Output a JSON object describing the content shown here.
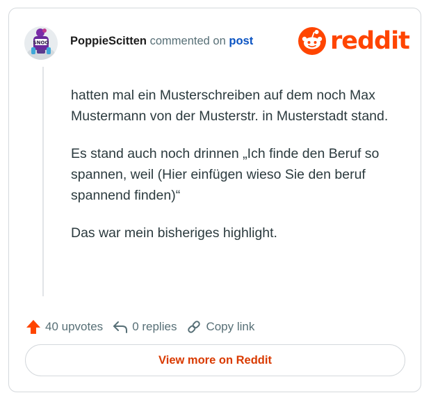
{
  "comment": {
    "username": "PoppieScitten",
    "action_text": "commented on",
    "post_link": "post",
    "paragraphs": [
      "hatten mal ein Musterschreiben auf dem noch Max Mustermann von der Musterstr. in Musterstadt stand.",
      "Es stand auch noch drinnen „Ich finde den Beruf so spannen, weil (Hier einfügen wieso Sie den beruf spannend finden)“",
      "Das war mein bisheriges highlight."
    ]
  },
  "logo": {
    "wordmark": "reddit"
  },
  "avatar": {
    "badge_text": "SNOO"
  },
  "actions": {
    "upvotes": "40 upvotes",
    "replies": "0 replies",
    "copy_link": "Copy link"
  },
  "footer": {
    "view_more_label": "View more on Reddit"
  },
  "colors": {
    "brand": "#ff4500",
    "button_text": "#d93a00",
    "link": "#0a53c2"
  }
}
